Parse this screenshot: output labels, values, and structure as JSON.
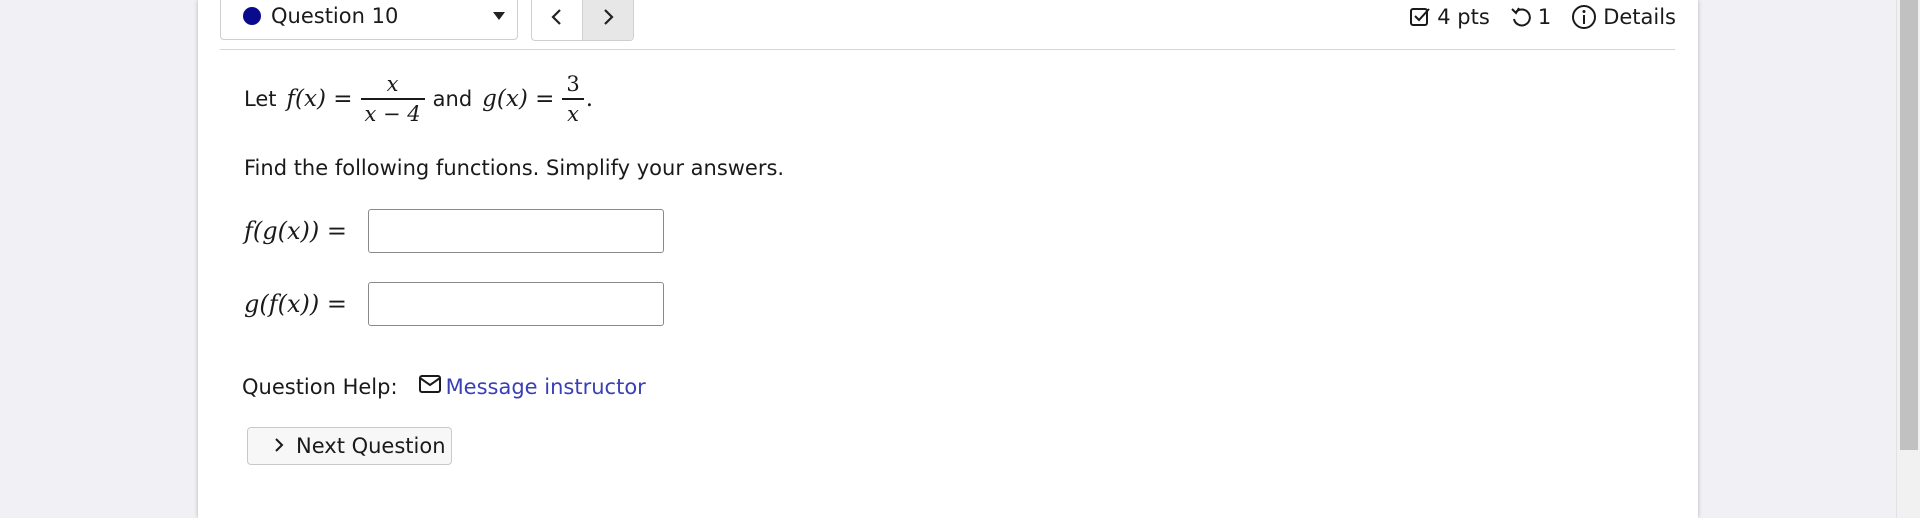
{
  "header": {
    "question_label": "Question 10",
    "question_status_color": "#0a0a8c",
    "prev_icon": "chevron-left-icon",
    "next_icon": "chevron-right-icon",
    "points": "4 pts",
    "attempts": "1",
    "details_label": "Details"
  },
  "problem": {
    "intro": "Let",
    "f_name": "f(x) =",
    "f_num": "x",
    "f_den": "x − 4",
    "conj": "and",
    "g_name": "g(x) =",
    "g_num": "3",
    "g_den": "x",
    "end": ".",
    "instructions": "Find the following functions. Simplify your answers."
  },
  "answers": [
    {
      "label": "f(g(x)) =",
      "value": ""
    },
    {
      "label": "g(f(x)) =",
      "value": ""
    }
  ],
  "help": {
    "label": "Question Help:",
    "message_link": "Message instructor"
  },
  "footer": {
    "next_question_label": "Next Question"
  }
}
